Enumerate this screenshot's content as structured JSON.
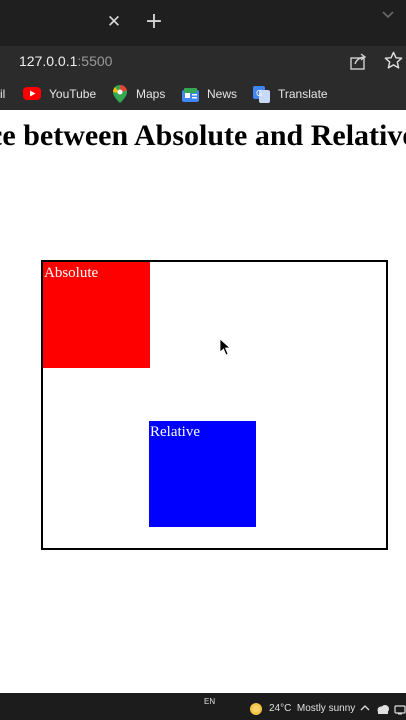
{
  "browser": {
    "url_host": "127.0.0.1",
    "url_port": ":5500",
    "bookmarks": [
      {
        "label": "il",
        "icon": "gmail-icon"
      },
      {
        "label": "YouTube",
        "icon": "youtube-icon"
      },
      {
        "label": "Maps",
        "icon": "maps-icon"
      },
      {
        "label": "News",
        "icon": "news-icon"
      },
      {
        "label": "Translate",
        "icon": "translate-icon"
      }
    ]
  },
  "page": {
    "heading": "Difference between Absolute and Relative",
    "absolute_label": "Absolute",
    "relative_label": "Relative",
    "colors": {
      "absolute_box": "#ff0000",
      "relative_box": "#0000ff",
      "container_border": "#000000"
    }
  },
  "taskbar": {
    "language": "EN",
    "temperature": "24°C",
    "weather": "Mostly sunny"
  }
}
